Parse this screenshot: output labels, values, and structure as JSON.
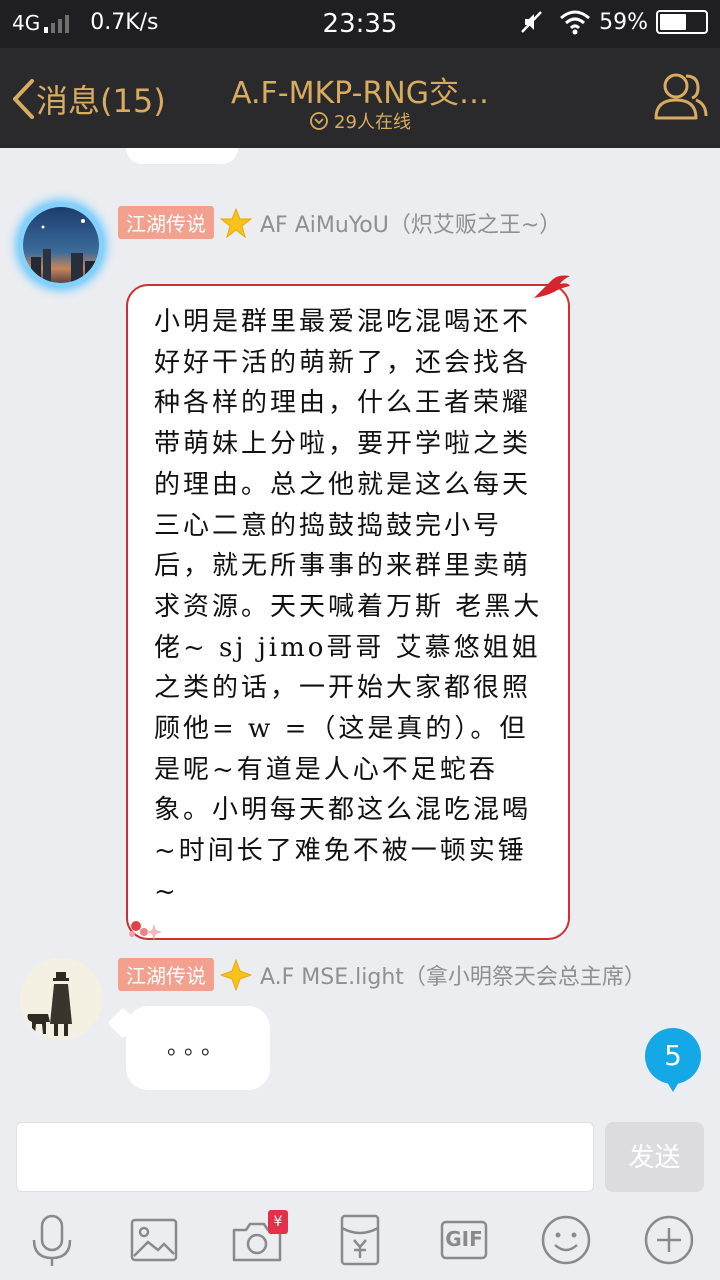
{
  "status_bar": {
    "network": "4G",
    "speed": "0.7K/s",
    "time": "23:35",
    "battery": "59%",
    "battery_level": 0.59
  },
  "header": {
    "back_label": "消息(15)",
    "title": "A.F-MKP-RNG交…",
    "online": "29人在线"
  },
  "messages": [
    {
      "badge": "江湖传说",
      "sender": "AF AiMuYoU（炽艾贩之王~）",
      "text": "小明是群里最爱混吃混喝还不好好干活的萌新了，还会找各种各样的理由，什么王者荣耀带萌妹上分啦，要开学啦之类的理由。总之他就是这么每天三心二意的捣鼓捣鼓完小号后，就无所事事的来群里卖萌求资源。天天喊着万斯 老黑大佬~ sj jimo哥哥  艾慕悠姐姐之类的话，一开始大家都很照顾他= w =（这是真的）。但是呢~有道是人心不足蛇吞象。小明每天都这么混吃混喝~时间长了难免不被一顿实锤~"
    },
    {
      "badge": "江湖传说",
      "sender": "A.F  MSE.light（拿小明祭天会总主席）",
      "text": "。。。"
    }
  ],
  "unread_count": "5",
  "input": {
    "value": "",
    "placeholder": "",
    "send_label": "发送"
  },
  "toolbar": {
    "gif_label": "GIF",
    "red_packet_label": "¥"
  },
  "colors": {
    "accent_gold": "#d8ab5f",
    "header_bg": "#2a2a2c",
    "badge": "#f3a08e",
    "bubble_border": "#cf2f2f",
    "unread": "#14a8e6"
  }
}
